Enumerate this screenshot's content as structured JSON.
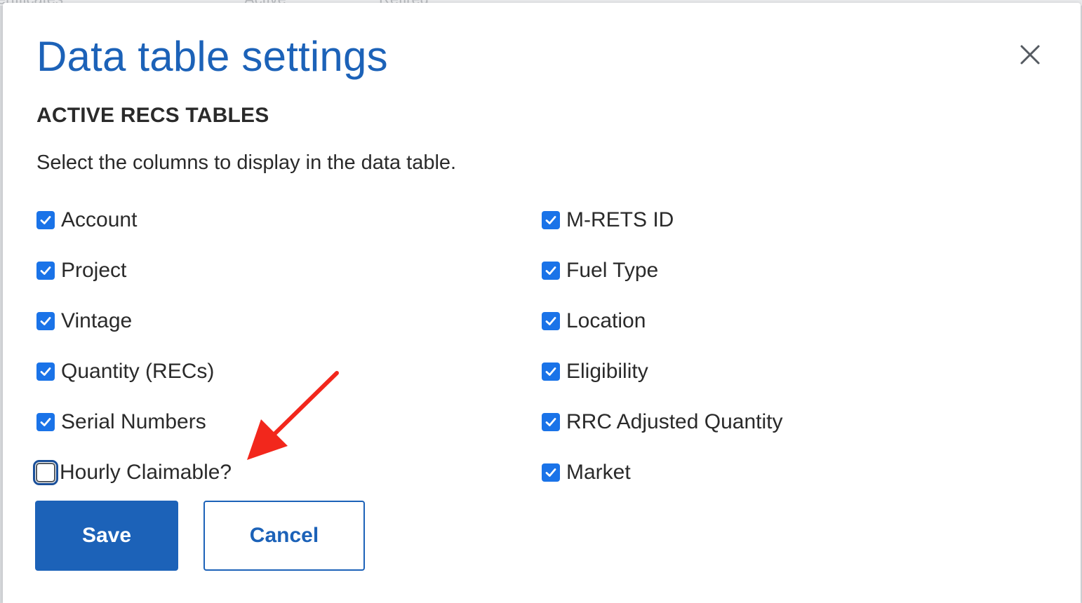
{
  "background": {
    "tabs": [
      "Certificates",
      "Active",
      "Retired"
    ]
  },
  "dialog": {
    "title": "Data table settings",
    "close_icon": "close-icon",
    "section_heading": "ACTIVE RECS TABLES",
    "instruction": "Select the columns to display in the data table.",
    "left_columns": [
      {
        "label": "Account",
        "checked": true
      },
      {
        "label": "Project",
        "checked": true
      },
      {
        "label": "Vintage",
        "checked": true
      },
      {
        "label": "Quantity (RECs)",
        "checked": true
      },
      {
        "label": "Serial Numbers",
        "checked": true
      },
      {
        "label": "Hourly Claimable?",
        "checked": false
      }
    ],
    "right_columns": [
      {
        "label": "M-RETS ID",
        "checked": true
      },
      {
        "label": "Fuel Type",
        "checked": true
      },
      {
        "label": "Location",
        "checked": true
      },
      {
        "label": "Eligibility",
        "checked": true
      },
      {
        "label": "RRC Adjusted Quantity",
        "checked": true
      },
      {
        "label": "Market",
        "checked": true
      }
    ],
    "save_label": "Save",
    "cancel_label": "Cancel"
  },
  "annotation": {
    "arrow_color": "#f2271c",
    "arrow_icon": "arrow-annotation-icon"
  },
  "colors": {
    "accent": "#1c62b8",
    "checkbox": "#1a73e8",
    "text": "#2a2a2a"
  }
}
